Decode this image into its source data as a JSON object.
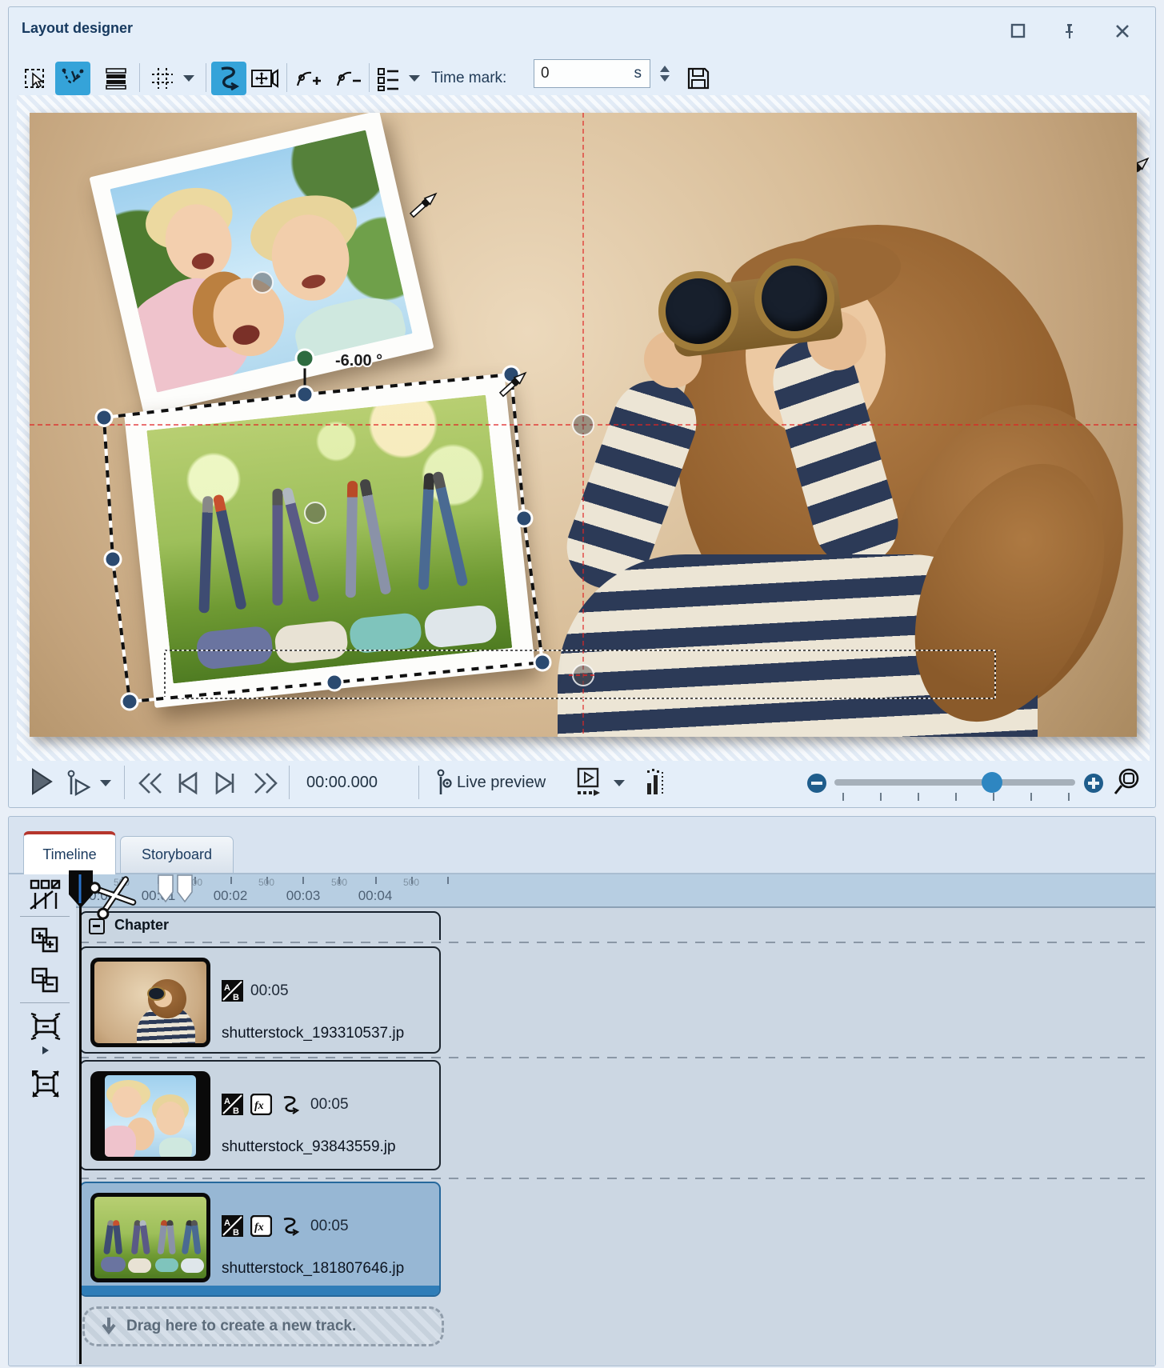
{
  "window": {
    "title": "Layout designer",
    "controls": [
      "maximize-icon",
      "pin-icon",
      "close-icon"
    ]
  },
  "toolbar": {
    "buttons": [
      "select-tool",
      "edit-curve-tool",
      "align-tool",
      "grid-tool",
      "grid-dropdown",
      "curve-mode-tool",
      "pan-view-tool",
      "add-keypoint-tool",
      "remove-keypoint-tool",
      "object-list-tool",
      "list-dropdown",
      "save-button"
    ],
    "time_mark_label": "Time mark:",
    "time_mark_value": "0",
    "time_mark_unit": "s"
  },
  "canvas": {
    "rotation_label": "-6.00 °",
    "selected_object": "polaroid-photo-2"
  },
  "playback": {
    "time": "00:00.000",
    "live_preview_label": "Live preview",
    "buttons": [
      "play",
      "play-from-marker",
      "play-options-dropdown",
      "rewind",
      "previous",
      "next",
      "fast-forward",
      "present-window",
      "present-dropdown",
      "levels",
      "zoom-out",
      "zoom-slider",
      "zoom-in",
      "zoom-fit"
    ]
  },
  "tabs": [
    {
      "label": "Timeline",
      "active": true
    },
    {
      "label": "Storyboard",
      "active": false
    }
  ],
  "timeline": {
    "left_tools": [
      "track-options",
      "expand-all",
      "collapse-all",
      "fit-width",
      "more-arrow",
      "fit-all"
    ],
    "ruler": {
      "seconds": [
        "00:00",
        "00:01",
        "00:02",
        "00:03",
        "00:04"
      ],
      "half_label": "500"
    },
    "chapter_label": "Chapter",
    "clips": [
      {
        "duration": "00:05",
        "filename": "shutterstock_193310537.jp",
        "icons": [
          "transition-ab"
        ],
        "selected": false
      },
      {
        "duration": "00:05",
        "filename": "shutterstock_93843559.jp",
        "icons": [
          "transition-ab",
          "effects-fx",
          "motion-curve"
        ],
        "selected": false
      },
      {
        "duration": "00:05",
        "filename": "shutterstock_181807646.jp",
        "icons": [
          "transition-ab",
          "effects-fx",
          "motion-curve"
        ],
        "selected": true
      }
    ],
    "drag_hint": "Drag here to create a new track."
  },
  "colors": {
    "accent_blue": "#35a3d9",
    "tab_red": "#b5352c",
    "crosshair_red": "#e02525",
    "handle_navy": "#2b4a70",
    "handle_green": "#2e6b40",
    "selected_clip": "#2f7db8"
  }
}
